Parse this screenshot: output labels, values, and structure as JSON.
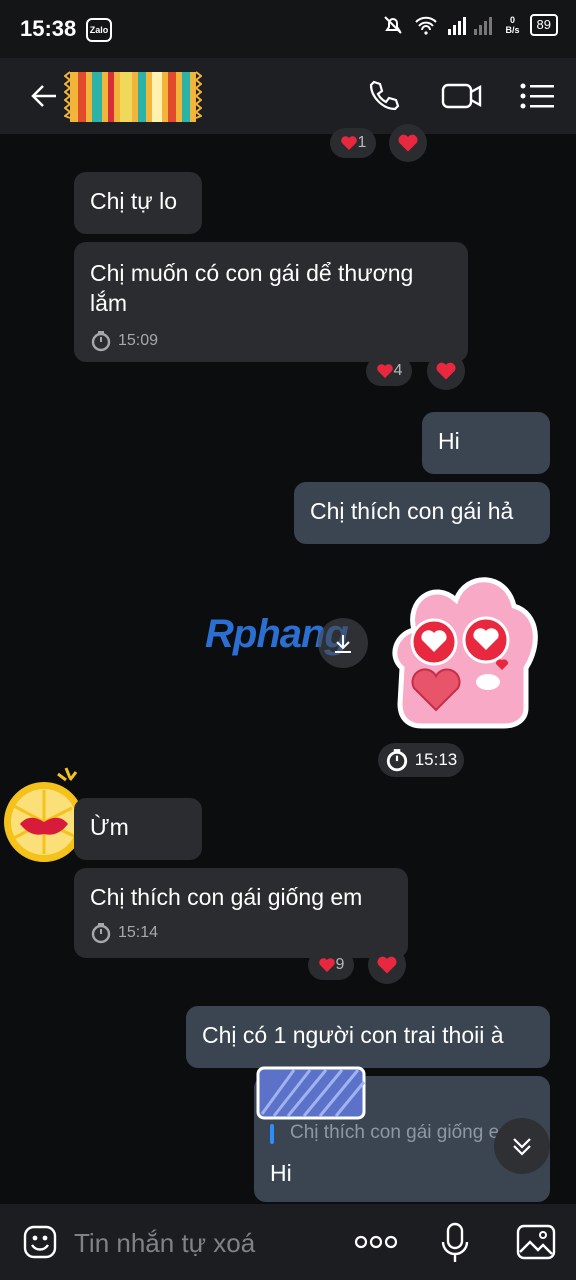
{
  "status": {
    "time": "15:38",
    "app_badge": "Zalo",
    "net_speed_value": "0",
    "net_speed_unit": "B/s",
    "battery": "89"
  },
  "messages": {
    "top_reaction_count": "1",
    "m1": "Chị tự lo",
    "m2": "Chị muốn có con gái dể thương lắm",
    "m2_time": "15:09",
    "m2_reaction_count": "4",
    "m3": "Hi",
    "m4": "Chị thích con gái hả",
    "sticker_time": "15:13",
    "watermark": "Rphang",
    "m5": "Ừm",
    "m6": "Chị thích con gái giống em",
    "m6_time": "15:14",
    "m6_reaction_count": "9",
    "m7": "Chị có 1 người con trai thoii à",
    "quote_text": "Chị thích con gái giống em",
    "m8": "Hi"
  },
  "composer": {
    "placeholder": "Tin nhắn tự xoá"
  },
  "colors": {
    "bubble_in": "#2b2c2f",
    "bubble_out": "#3b4552",
    "background": "#0c0d0f",
    "heart": "#e8283e"
  }
}
